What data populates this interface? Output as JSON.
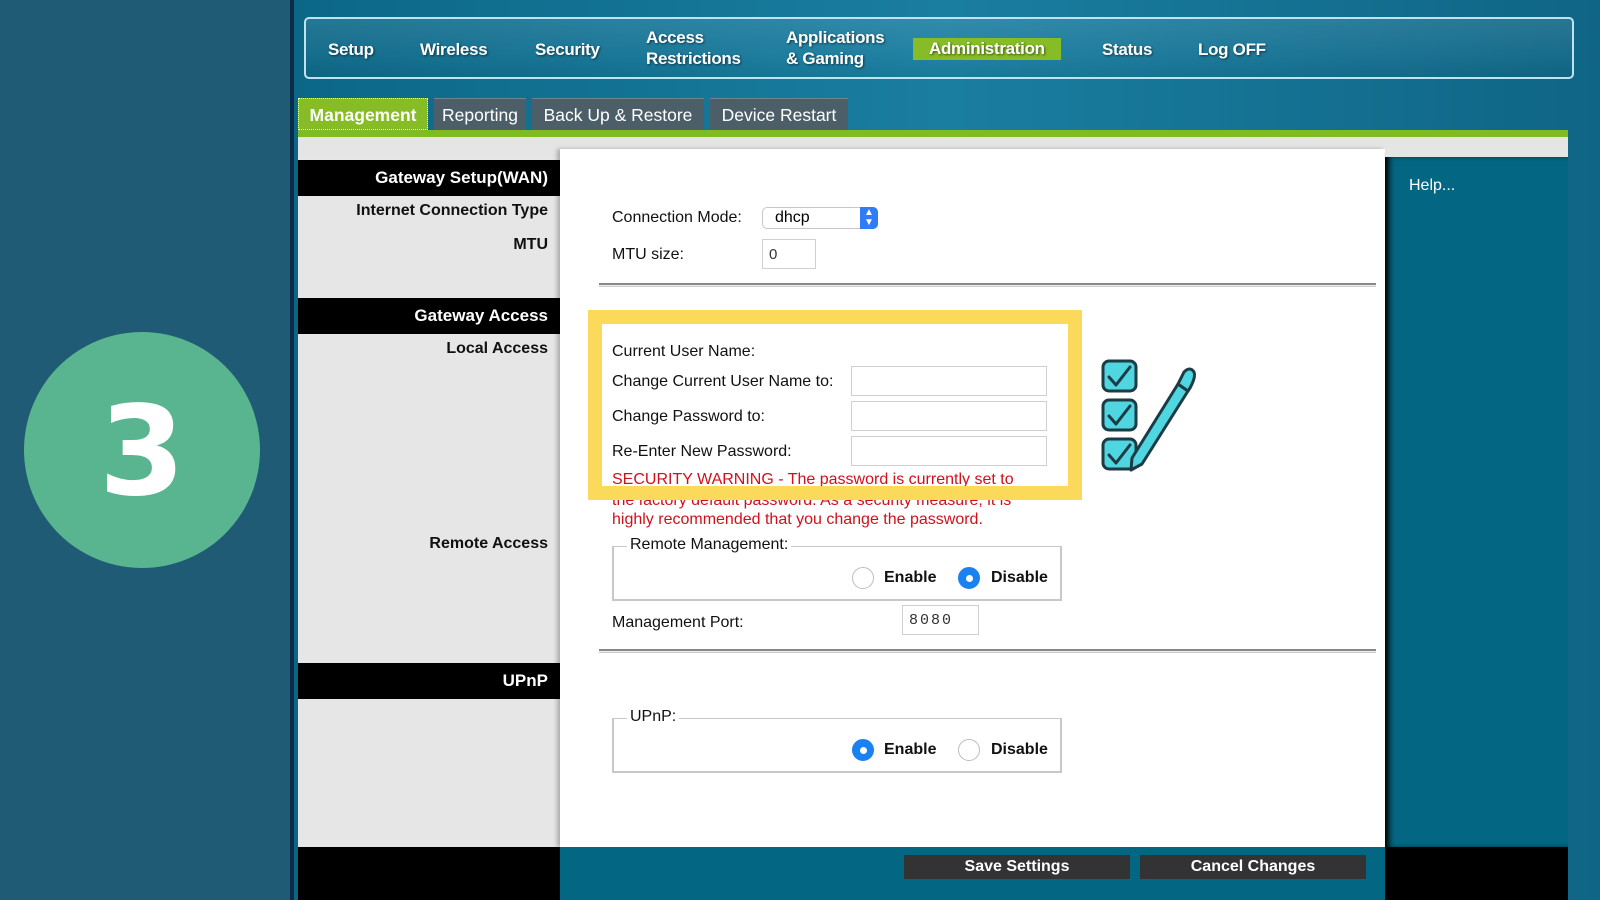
{
  "step": {
    "number": "3"
  },
  "colors": {
    "accent_green": "#86bc25",
    "router_teal": "#036682",
    "step_circle": "#59b58f",
    "highlight_yellow": "#fbd95b",
    "warning_red": "#d0111b",
    "radio_blue": "#1a82f0"
  },
  "topnav": {
    "items": [
      {
        "label": "Setup",
        "active": false
      },
      {
        "label": "Wireless",
        "active": false
      },
      {
        "label": "Security",
        "active": false
      },
      {
        "label": "Access",
        "label2": "Restrictions",
        "active": false
      },
      {
        "label": "Applications",
        "label2": "& Gaming",
        "active": false
      },
      {
        "label": "Administration",
        "active": true
      },
      {
        "label": "Status",
        "active": false
      },
      {
        "label": "Log OFF",
        "active": false
      }
    ]
  },
  "subnav": {
    "tabs": [
      {
        "label": "Management",
        "active": true
      },
      {
        "label": "Reporting",
        "active": false
      },
      {
        "label": "Back Up & Restore",
        "active": false
      },
      {
        "label": "Device Restart",
        "active": false
      }
    ]
  },
  "sidebar": {
    "sections": [
      {
        "header": "Gateway Setup(WAN)",
        "labels": [
          "Internet Connection Type",
          "MTU"
        ]
      },
      {
        "header": "Gateway Access",
        "labels": [
          "Local Access",
          "Remote Access"
        ]
      },
      {
        "header": "UPnP",
        "labels": []
      }
    ]
  },
  "wan": {
    "connection_mode_label": "Connection Mode:",
    "connection_mode_value": "dhcp",
    "mtu_label": "MTU size:",
    "mtu_value": "0"
  },
  "local_access": {
    "current_user_label": "Current User Name:",
    "change_user_label": "Change Current User Name to:",
    "change_user_value": "",
    "change_password_label": "Change Password to:",
    "change_password_value": "",
    "reenter_password_label": "Re-Enter New Password:",
    "reenter_password_value": "",
    "warning_lines": [
      "SECURITY WARNING - The password is currently set to",
      "the factory default password. As a security measure, it is",
      "highly recommended that you change the password."
    ]
  },
  "remote_access": {
    "legend": "Remote Management:",
    "options": [
      {
        "label": "Enable",
        "checked": false
      },
      {
        "label": "Disable",
        "checked": true
      }
    ],
    "port_label": "Management Port:",
    "port_value": "8080"
  },
  "upnp": {
    "legend": "UPnP:",
    "options": [
      {
        "label": "Enable",
        "checked": true
      },
      {
        "label": "Disable",
        "checked": false
      }
    ]
  },
  "help": {
    "label": "Help..."
  },
  "footer": {
    "save_label": "Save Settings",
    "cancel_label": "Cancel Changes"
  },
  "decorations": {
    "checklist_icon": "checklist-with-pen-icon"
  }
}
